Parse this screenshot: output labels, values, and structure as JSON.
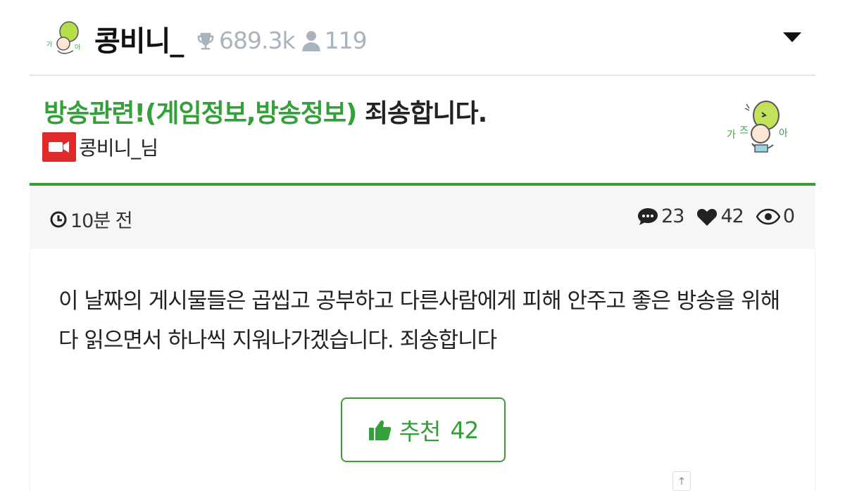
{
  "header": {
    "channel_name": "콩비니_",
    "trophy_count": "689.3k",
    "follower_count": "119",
    "icons": [
      "trophy-icon",
      "user-icon",
      "caret-down-icon"
    ]
  },
  "post": {
    "category": "방송관련!(게임정보,방송정보)",
    "title": " 죄송합니다.",
    "author": "콩비니_님",
    "time": "10분 전",
    "comments": "23",
    "likes": "42",
    "views": "0",
    "content": "이 날짜의 게시물들은 곱씹고 공부하고 다른사람에게 피해 안주고 좋은 방송을 위해 다 읽으면서 하나씩 지워나가겠습니다. 죄송합니다",
    "recommend_label": "추천",
    "recommend_count": "42"
  },
  "colors": {
    "accent_green": "#33a03a",
    "divider_green": "#3c9a35",
    "muted_gray": "#a8b3bd",
    "camera_red": "#e0292b"
  }
}
